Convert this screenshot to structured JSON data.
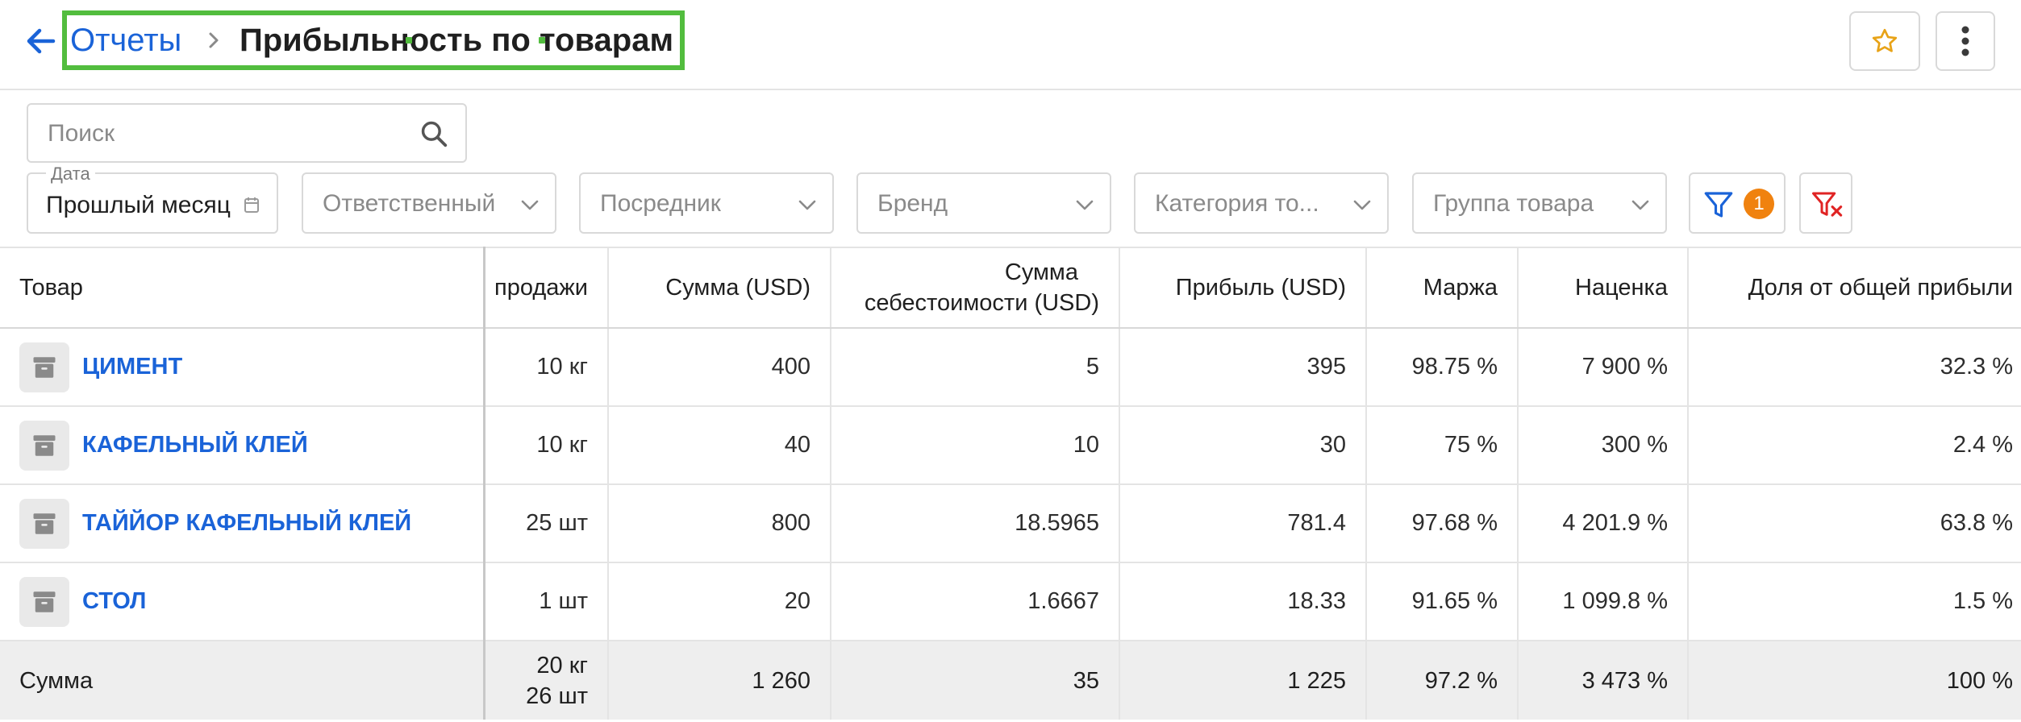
{
  "header": {
    "breadcrumb_parent": "Отчеты",
    "title": "Прибыльность по товарам"
  },
  "filters": {
    "search_placeholder": "Поиск",
    "date_label": "Дата",
    "date_value": "Прошлый месяц",
    "responsible_placeholder": "Ответственный",
    "intermediary_placeholder": "Посредник",
    "brand_placeholder": "Бренд",
    "category_placeholder": "Категория то...",
    "group_placeholder": "Группа товара",
    "active_filter_count": "1"
  },
  "table": {
    "columns": {
      "product": "Товар",
      "sales": "продажи",
      "amount": "Сумма (USD)",
      "cost_line1": "Сумма",
      "cost_line2": "себестоимости (USD)",
      "profit": "Прибыль (USD)",
      "margin": "Маржа",
      "markup": "Наценка",
      "share": "Доля от общей прибыли"
    },
    "rows": [
      {
        "product": "ЦИМЕНТ",
        "sales": "10 кг",
        "amount": "400",
        "cost": "5",
        "profit": "395",
        "margin": "98.75 %",
        "markup": "7 900 %",
        "share": "32.3 %"
      },
      {
        "product": "КАФЕЛЬНЫЙ КЛЕЙ",
        "sales": "10 кг",
        "amount": "40",
        "cost": "10",
        "profit": "30",
        "margin": "75 %",
        "markup": "300 %",
        "share": "2.4 %"
      },
      {
        "product": "ТАЙЙОР КАФЕЛЬНЫЙ КЛЕЙ",
        "sales": "25 шт",
        "amount": "800",
        "cost": "18.5965",
        "profit": "781.4",
        "margin": "97.68 %",
        "markup": "4 201.9 %",
        "share": "63.8 %"
      },
      {
        "product": "СТОЛ",
        "sales": "1 шт",
        "amount": "20",
        "cost": "1.6667",
        "profit": "18.33",
        "margin": "91.65 %",
        "markup": "1 099.8 %",
        "share": "1.5 %"
      }
    ],
    "total": {
      "label": "Сумма",
      "sales_line1": "20 кг",
      "sales_line2": "26 шт",
      "amount": "1 260",
      "cost": "35",
      "profit": "1 225",
      "margin": "97.2 %",
      "markup": "3 473 %",
      "share": "100 %"
    }
  },
  "icons": {
    "back": "arrow-left-icon",
    "separator": "chevron-right-icon",
    "favorite": "star-icon",
    "menu": "more-vertical-icon",
    "search": "search-icon",
    "calendar": "calendar-icon",
    "dropdown": "chevron-down-icon",
    "filter": "filter-icon",
    "clear_filter": "filter-clear-icon",
    "product": "archive-box-icon"
  },
  "colors": {
    "link": "#1a63d8",
    "accent_star": "#e8a317",
    "badge": "#f0820f",
    "filter_icon": "#1a63d8",
    "clear_icon": "#e02424",
    "highlight_box": "#52bd3e",
    "total_row_bg": "#eeeeee"
  }
}
